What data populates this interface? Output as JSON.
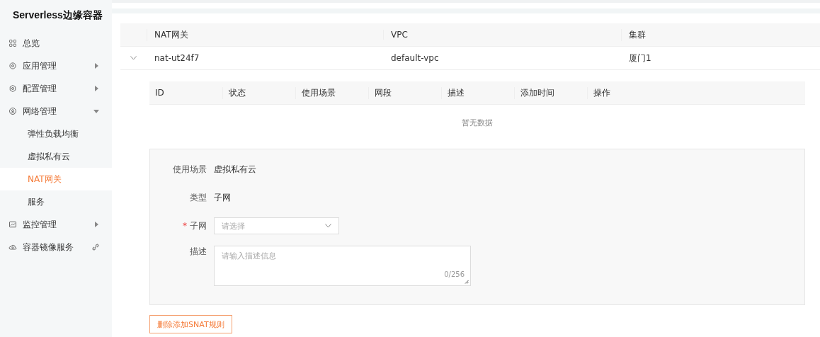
{
  "sidebar": {
    "title": "Serverless边缘容器",
    "items": [
      {
        "label": "总览",
        "kind": "item",
        "selected": false
      },
      {
        "label": "应用管理",
        "kind": "submenu",
        "selected": false,
        "expanded": false
      },
      {
        "label": "配置管理",
        "kind": "submenu",
        "selected": false,
        "expanded": false
      },
      {
        "label": "网络管理",
        "kind": "submenu",
        "selected": false,
        "expanded": true,
        "children": [
          {
            "label": "弹性负载均衡",
            "selected": false
          },
          {
            "label": "虚拟私有云",
            "selected": false
          },
          {
            "label": "NAT网关",
            "selected": true
          },
          {
            "label": "服务",
            "selected": false
          }
        ]
      },
      {
        "label": "监控管理",
        "kind": "submenu",
        "selected": false,
        "expanded": false
      },
      {
        "label": "容器镜像服务",
        "kind": "external",
        "selected": false
      }
    ]
  },
  "table": {
    "columns": [
      "NAT网关",
      "VPC",
      "集群"
    ],
    "rows": [
      {
        "expanded": true,
        "cells": [
          "nat-ut24f7",
          "default-vpc",
          "厦门1"
        ],
        "detail": {
          "columns": [
            "ID",
            "状态",
            "使用场景",
            "网段",
            "描述",
            "添加时间",
            "操作"
          ],
          "empty_text": "暂无数据",
          "form": {
            "fields": [
              {
                "kind": "text",
                "label": "使用场景",
                "value": "虚拟私有云"
              },
              {
                "kind": "text",
                "label": "类型",
                "value": "子网"
              },
              {
                "kind": "select",
                "label": "子网",
                "required_mark": "*",
                "placeholder": "请选择"
              },
              {
                "kind": "textarea",
                "label": "描述",
                "placeholder": "请输入描述信息",
                "counter": "0/256"
              }
            ]
          },
          "button": "删除添加SNAT规则"
        }
      }
    ]
  }
}
